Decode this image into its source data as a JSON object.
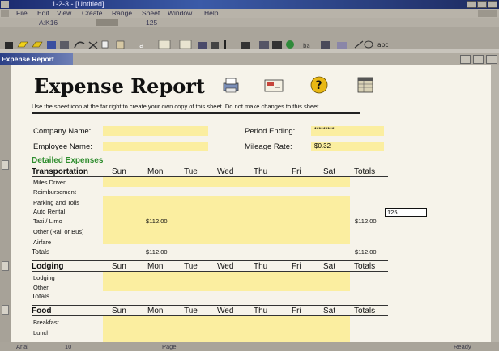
{
  "window": {
    "title": "1-2-3 - [Untitled]"
  },
  "menu": [
    "File",
    "Edit",
    "View",
    "Create",
    "Range",
    "Sheet",
    "Window",
    "Help"
  ],
  "edit_line": {
    "address": "A:K16",
    "content": "125"
  },
  "doc_tab": "Expense Report",
  "sheet": {
    "title": "Expense Report",
    "instructions": "Use the sheet icon at the far right to create your own copy of this sheet.  Do not make changes to this sheet.",
    "company_label": "Company Name:",
    "employee_label": "Employee Name:",
    "period_label": "Period Ending:",
    "period_value": "*********",
    "mileage_label": "Mileage Rate:",
    "mileage_value": "$0.32",
    "detailed_label": "Detailed Expenses",
    "days": [
      "Sun",
      "Mon",
      "Tue",
      "Wed",
      "Thu",
      "Fri",
      "Sat",
      "Totals"
    ],
    "transportation": {
      "title": "Transportation",
      "rows": [
        "Miles Driven",
        "Reimbursement",
        "Parking and Tolls",
        "Auto Rental",
        "Taxi / Limo",
        "Other (Rail or Bus)",
        "Airfare"
      ],
      "taxi_mon": "$112.00",
      "taxi_total": "$112.00",
      "totals_label": "Totals",
      "totals_mon": "$112.00",
      "totals_total": "$112.00"
    },
    "lodging": {
      "title": "Lodging",
      "rows": [
        "Lodging",
        "Other"
      ],
      "totals_label": "Totals"
    },
    "food": {
      "title": "Food",
      "rows": [
        "Breakfast",
        "Lunch"
      ]
    },
    "selected_cell_value": "125"
  },
  "status": [
    "Arial",
    "10",
    "Page",
    "Ready"
  ]
}
